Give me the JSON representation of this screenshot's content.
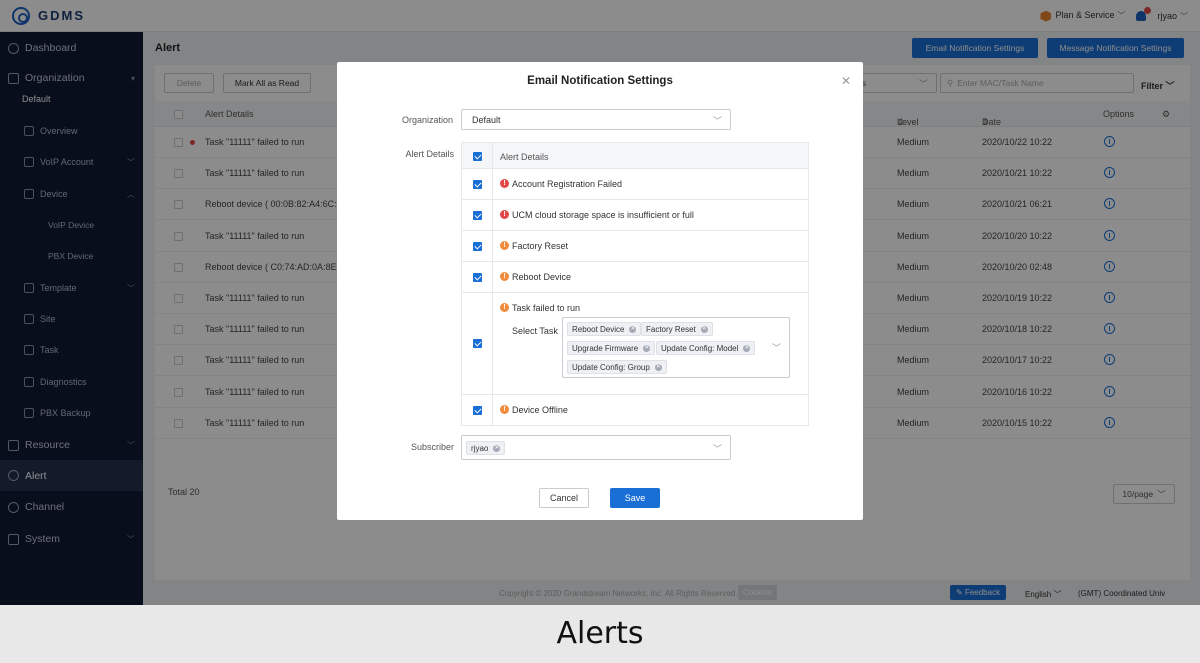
{
  "app": {
    "logo_text": "GDMS"
  },
  "topbar": {
    "plan_label": "Plan & Service",
    "user": "rjyao"
  },
  "sidebar": {
    "dashboard": "Dashboard",
    "organization": "Organization",
    "org_default": "Default",
    "overview": "Overview",
    "voip_account": "VoIP Account",
    "device": "Device",
    "voip_device": "VoIP Device",
    "pbx_device": "PBX Device",
    "template": "Template",
    "site": "Site",
    "task": "Task",
    "diagnostics": "Diagnostics",
    "pbx_backup": "PBX Backup",
    "resource": "Resource",
    "alert": "Alert",
    "channel": "Channel",
    "system": "System"
  },
  "page": {
    "title": "Alert",
    "email_settings_btn": "Email Notification Settings",
    "message_settings_btn": "Message Notification Settings",
    "delete_btn": "Delete",
    "mark_all_btn": "Mark All as Read",
    "type_select_partial": "ls",
    "search_placeholder": "Enter MAC/Task Name",
    "filter_label": "Filter",
    "columns": {
      "details": "Alert Details",
      "level": "Level",
      "date": "Date",
      "options": "Options"
    },
    "rows": [
      {
        "details": "Task \"11111\" failed to run",
        "level": "Medium",
        "date": "2020/10/22 10:22",
        "unread": true
      },
      {
        "details": "Task \"11111\" failed to run",
        "level": "Medium",
        "date": "2020/10/21 10:22",
        "unread": false
      },
      {
        "details": "Reboot device ( 00:0B:82:A4:6C:4",
        "level": "Medium",
        "date": "2020/10/21 06:21",
        "unread": false
      },
      {
        "details": "Task \"11111\" failed to run",
        "level": "Medium",
        "date": "2020/10/20 10:22",
        "unread": false
      },
      {
        "details": "Reboot device ( C0:74:AD:0A:8E:9",
        "level": "Medium",
        "date": "2020/10/20 02:48",
        "unread": false
      },
      {
        "details": "Task \"11111\" failed to run",
        "level": "Medium",
        "date": "2020/10/19 10:22",
        "unread": false
      },
      {
        "details": "Task \"11111\" failed to run",
        "level": "Medium",
        "date": "2020/10/18 10:22",
        "unread": false
      },
      {
        "details": "Task \"11111\" failed to run",
        "level": "Medium",
        "date": "2020/10/17 10:22",
        "unread": false
      },
      {
        "details": "Task \"11111\" failed to run",
        "level": "Medium",
        "date": "2020/10/16 10:22",
        "unread": false
      },
      {
        "details": "Task \"11111\" failed to run",
        "level": "Medium",
        "date": "2020/10/15 10:22",
        "unread": false
      }
    ],
    "total": "Total 20",
    "page_size": "10/page"
  },
  "footer": {
    "copyright": "Copyright © 2020 Grandstream Networks, Inc. All Rights Reserved.",
    "cookies": "Cookies",
    "feedback": "Feedback",
    "language": "English",
    "timezone": "(GMT) Coordinated Univ"
  },
  "modal": {
    "title": "Email Notification Settings",
    "org_label": "Organization",
    "org_value": "Default",
    "alert_details_label": "Alert Details",
    "header_label": "Alert Details",
    "items": {
      "account_registration": "Account Registration Failed",
      "ucm_storage": "UCM cloud storage space is insufficient or full",
      "factory_reset": "Factory Reset",
      "reboot_device": "Reboot Device",
      "task_failed": "Task failed to run",
      "device_offline": "Device Offline"
    },
    "select_task_label": "Select Task",
    "tasks": [
      "Reboot Device",
      "Factory Reset",
      "Upgrade Firmware",
      "Update Config: Model",
      "Update Config: Group"
    ],
    "subscriber_label": "Subscriber",
    "subscriber_value": "rjyao",
    "cancel": "Cancel",
    "save": "Save"
  },
  "caption": "Alerts"
}
